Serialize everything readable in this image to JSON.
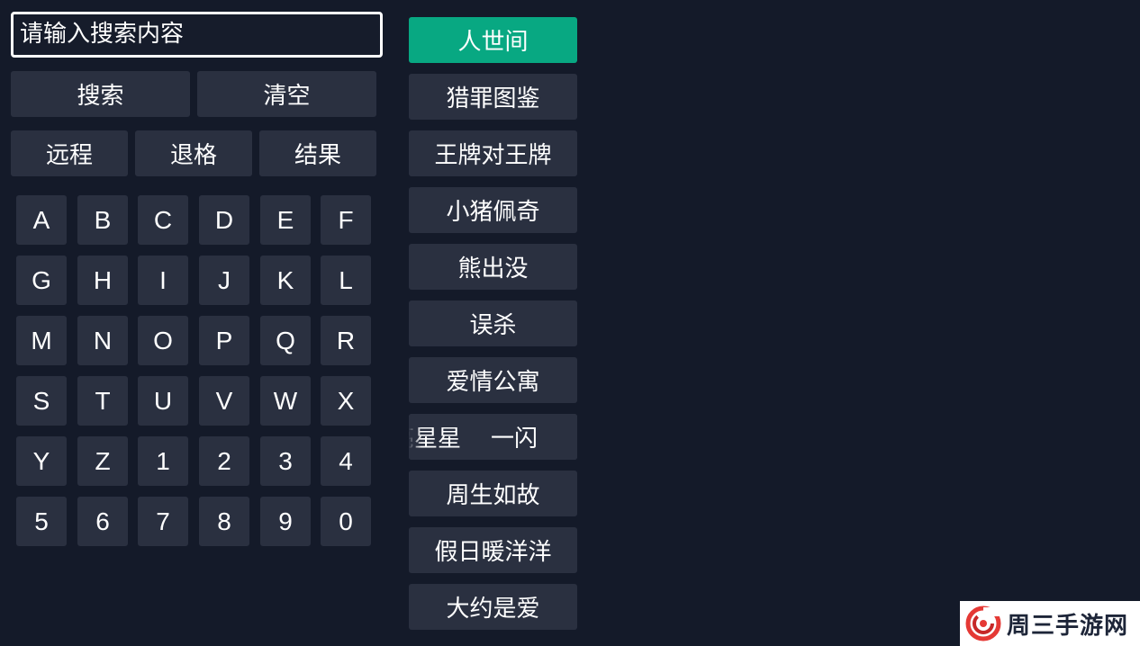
{
  "search": {
    "placeholder": "请输入搜索内容"
  },
  "actions": {
    "search": "搜索",
    "clear": "清空",
    "remote": "远程",
    "backspace": "退格",
    "results": "结果"
  },
  "keyboard": {
    "keys": [
      "A",
      "B",
      "C",
      "D",
      "E",
      "F",
      "G",
      "H",
      "I",
      "J",
      "K",
      "L",
      "M",
      "N",
      "O",
      "P",
      "Q",
      "R",
      "S",
      "T",
      "U",
      "V",
      "W",
      "X",
      "Y",
      "Z",
      "1",
      "2",
      "3",
      "4",
      "5",
      "6",
      "7",
      "8",
      "9",
      "0"
    ]
  },
  "results": {
    "items": [
      "人世间",
      "猎罪图鉴",
      "王牌对王牌",
      "小猪佩奇",
      "熊出没",
      "误杀",
      "爱情公寓",
      "亮星星    一闪",
      "周生如故",
      "假日暖洋洋",
      "大约是爱"
    ],
    "active_index": 0
  },
  "watermark": {
    "text": "周三手游网"
  },
  "colors": {
    "background": "#141a29",
    "button": "#2a3040",
    "accent": "#08a882"
  }
}
